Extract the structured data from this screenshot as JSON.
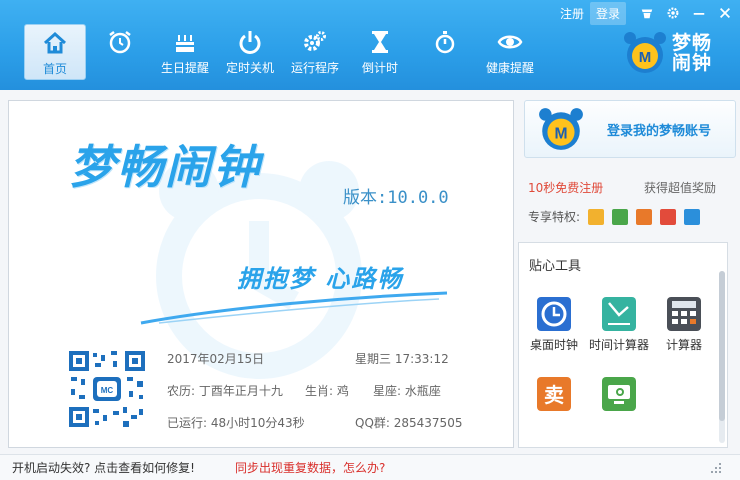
{
  "topbar": {
    "register": "注册",
    "login": "登录"
  },
  "nav": [
    {
      "id": "home",
      "label": "首页",
      "icon": "home-icon"
    },
    {
      "id": "alarm",
      "label": "",
      "icon": "alarm-clock-icon"
    },
    {
      "id": "birthday",
      "label": "生日提醒",
      "icon": "birthday-cake-icon"
    },
    {
      "id": "shutdown",
      "label": "定时关机",
      "icon": "power-icon"
    },
    {
      "id": "run",
      "label": "运行程序",
      "icon": "gears-icon"
    },
    {
      "id": "countdown",
      "label": "倒计时",
      "icon": "hourglass-icon"
    },
    {
      "id": "stopwatch",
      "label": "",
      "icon": "stopwatch-icon"
    },
    {
      "id": "health",
      "label": "健康提醒",
      "icon": "eye-icon"
    }
  ],
  "brand": {
    "name": "梦畅闹钟"
  },
  "main": {
    "logo": "梦畅闹钟",
    "version": "版本:10.0.0",
    "slogan": "拥抱梦 心路畅",
    "date": "2017年02月15日",
    "weekday_time": "星期三 17:33:12",
    "lunar": "农历: 丁酉年正月十九",
    "zodiac": "生肖: 鸡",
    "constellation": "星座: 水瓶座",
    "uptime": "已运行: 48小时10分43秒",
    "qq_group": "QQ群: 285437505"
  },
  "account": {
    "login_text": "登录我的梦畅账号"
  },
  "promo": {
    "register": "10秒免费注册",
    "bonus": "获得超值奖励",
    "perks_label": "专享特权:"
  },
  "tools": {
    "title": "贴心工具",
    "items": [
      {
        "label": "桌面时钟",
        "icon": "desktop-clock-icon",
        "color": "#2b6fd1"
      },
      {
        "label": "时间计算器",
        "icon": "time-calculator-icon",
        "color": "#35b3a0"
      },
      {
        "label": "计算器",
        "icon": "calculator-icon",
        "color": "#4a4f57"
      },
      {
        "label": "",
        "icon": "sell-reminder-icon",
        "color": "#e8792a"
      },
      {
        "label": "",
        "icon": "monitor-icon",
        "color": "#4aa64a"
      }
    ]
  },
  "status": {
    "link1": "开机启动失效? 点击查看如何修复!",
    "link2": "同步出现重复数据，怎么办?"
  }
}
